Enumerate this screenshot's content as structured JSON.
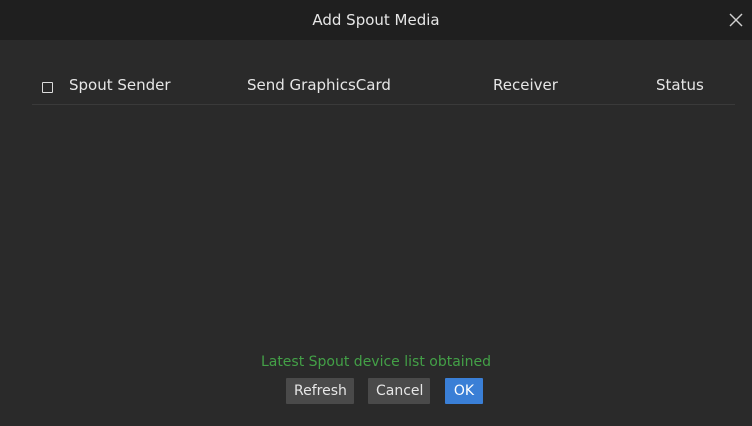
{
  "dialog": {
    "title": "Add Spout Media",
    "close_icon": "close-icon"
  },
  "table": {
    "select_all_checked": false,
    "columns": [
      "Spout Sender",
      "Send GraphicsCard",
      "Receiver",
      "Status"
    ],
    "rows": []
  },
  "status": {
    "message": "Latest Spout device list obtained",
    "color": "#43a047"
  },
  "buttons": {
    "refresh": "Refresh",
    "cancel": "Cancel",
    "ok": "OK",
    "accent": "#3a7fd6"
  }
}
